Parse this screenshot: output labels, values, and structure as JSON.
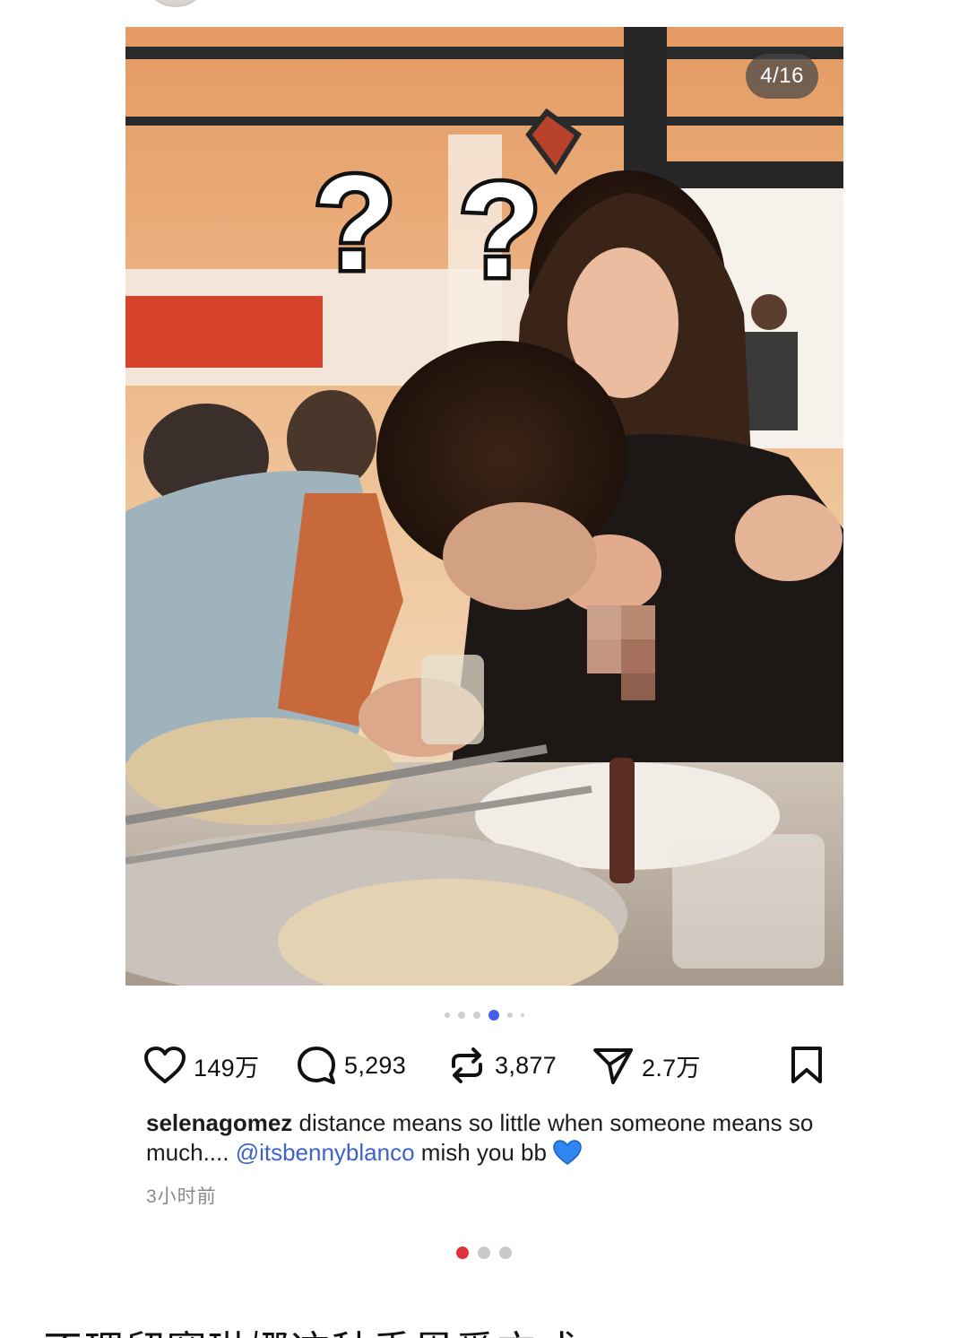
{
  "post": {
    "image_counter": "4/16",
    "image_alt": "selenagomez post photo",
    "overlay_marks": [
      "?",
      "?"
    ]
  },
  "carousel": {
    "total_dots": 6,
    "active_index": 3
  },
  "actions": {
    "likes": "149万",
    "comments": "5,293",
    "reposts": "3,877",
    "shares": "2.7万"
  },
  "caption": {
    "username": "selenagomez",
    "text_before_mention": " distance means so little when someone means so much.... ",
    "mention": "@itsbennyblanco",
    "text_after_mention": " mish you bb"
  },
  "timestamp": "3小时前",
  "pagination": {
    "total": 3,
    "active_index": 0
  },
  "article": {
    "heading": "不理留赛琳娜这种秀恩爱方式"
  },
  "colors": {
    "accent_blue": "#4361e8",
    "mention_blue": "#3d63c8",
    "active_page_red": "#e0323c",
    "heart_emoji_blue": "#2f86f0"
  },
  "icons": {
    "like": "heart-outline-icon",
    "comment": "speech-bubble-icon",
    "repost": "repost-arrows-icon",
    "share": "paper-plane-icon",
    "save": "bookmark-icon",
    "caption_emoji": "blue-heart-emoji-icon"
  }
}
